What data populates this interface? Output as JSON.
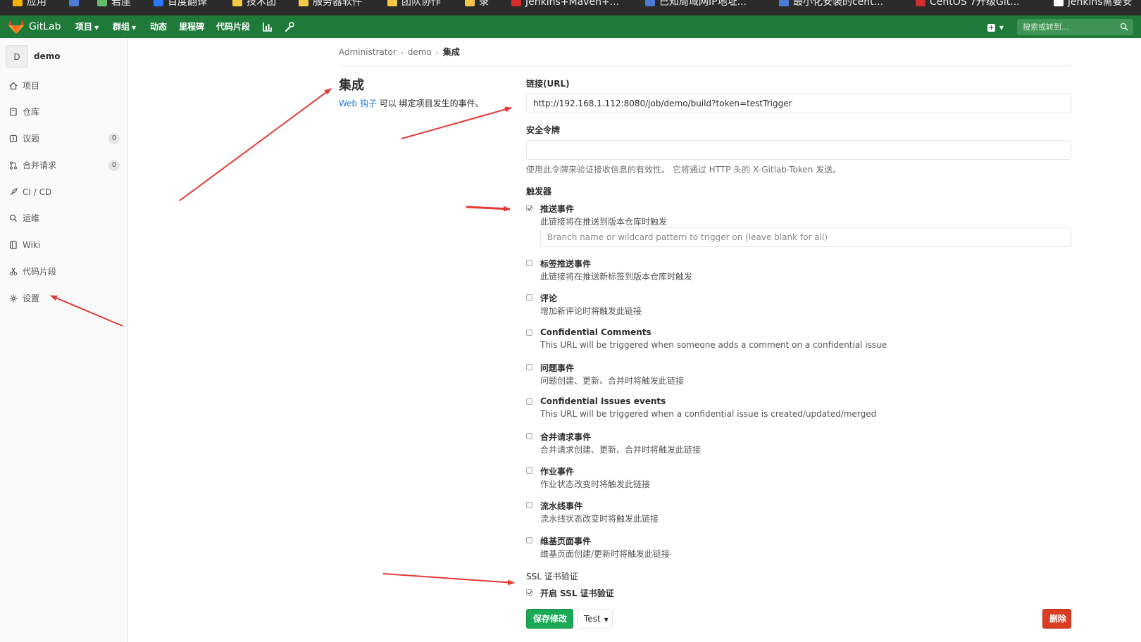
{
  "bookmarks": [
    {
      "label": "应用",
      "color": "#f4b400"
    },
    {
      "label": "",
      "color": "#4a7bd6"
    },
    {
      "label": "岩崖",
      "color": "#66bb6a"
    },
    {
      "label": "百度翻译",
      "color": "#2979ff"
    },
    {
      "label": "技术团",
      "color": "#f6c945"
    },
    {
      "label": "服务器软件",
      "color": "#f6c945"
    },
    {
      "label": "团队协作",
      "color": "#f6c945"
    },
    {
      "label": "录",
      "color": "#f6c945"
    },
    {
      "label": "Jenkins+Maven+...",
      "color": "#d32f2f"
    },
    {
      "label": "已知局域网IP地址...",
      "color": "#4a7bd6"
    },
    {
      "label": "最小化安装的cent...",
      "color": "#4a7bd6"
    },
    {
      "label": "CentOS 7升级Git...",
      "color": "#d32f2f"
    },
    {
      "label": "jenkins需要安",
      "color": "#ffffff"
    }
  ],
  "nav": {
    "brand": "GitLab",
    "projects": "项目",
    "groups": "群组",
    "activity": "动态",
    "milestones": "里程碑",
    "snippets": "代码片段",
    "search_placeholder": "搜索或转到..."
  },
  "sidebar": {
    "avatar_letter": "D",
    "project_name": "demo",
    "items": [
      {
        "label": "项目",
        "icon": "home-icon"
      },
      {
        "label": "仓库",
        "icon": "repository-icon"
      },
      {
        "label": "议题",
        "icon": "issues-icon",
        "count": "0"
      },
      {
        "label": "合并请求",
        "icon": "merge-request-icon",
        "count": "0"
      },
      {
        "label": "CI / CD",
        "icon": "rocket-icon"
      },
      {
        "label": "运维",
        "icon": "cloud-icon"
      },
      {
        "label": "Wiki",
        "icon": "book-icon"
      },
      {
        "label": "代码片段",
        "icon": "scissors-icon"
      },
      {
        "label": "设置",
        "icon": "gear-icon"
      }
    ]
  },
  "breadcrumb": {
    "root": "Administrator",
    "project": "demo",
    "current": "集成"
  },
  "heading": {
    "title": "集成",
    "link": "Web 钩子",
    "desc": " 可以 绑定项目发生的事件。"
  },
  "form": {
    "url_label": "链接(URL)",
    "url_value": "http://192.168.1.112:8080/job/demo/build?token=testTrigger",
    "token_label": "安全令牌",
    "token_value": "",
    "token_help": "使用此令牌来验证接收信息的有效性。 它将通过 HTTP 头的 X-Gitlab-Token 发送。",
    "triggers_label": "触发器",
    "branch_placeholder": "Branch name or wildcard pattern to trigger on (leave blank for all)",
    "triggers": [
      {
        "name": "推送事件",
        "desc": "此链接将在推送到版本仓库时触发",
        "checked": true
      },
      {
        "name": "标签推送事件",
        "desc": "此链接将在推送新标签到版本仓库时触发",
        "checked": false
      },
      {
        "name": "评论",
        "desc": "增加新评论时将触发此链接",
        "checked": false
      },
      {
        "name": "Confidential Comments",
        "desc": "This URL will be triggered when someone adds a comment on a confidential issue",
        "checked": false
      },
      {
        "name": "问题事件",
        "desc": "问题创建、更新、合并时将触发此链接",
        "checked": false
      },
      {
        "name": "Confidential Issues events",
        "desc": "This URL will be triggered when a confidential issue is created/updated/merged",
        "checked": false
      },
      {
        "name": "合并请求事件",
        "desc": "合并请求创建、更新、合并时将触发此链接",
        "checked": false
      },
      {
        "name": "作业事件",
        "desc": "作业状态改变时将触发此链接",
        "checked": false
      },
      {
        "name": "流水线事件",
        "desc": "流水线状态改变时将触发此链接",
        "checked": false
      },
      {
        "name": "维基页面事件",
        "desc": "维基页面创建/更新时将触发此链接",
        "checked": false
      }
    ],
    "ssl_label": "SSL 证书验证",
    "ssl_option": "开启 SSL 证书验证",
    "ssl_checked": true,
    "save": "保存修改",
    "test": "Test",
    "delete": "删除"
  },
  "colors": {
    "nav": "#1f7a3a",
    "save": "#1aaa55",
    "delete": "#db3b21",
    "link": "#1f78d1",
    "annotation": "#e53935"
  }
}
